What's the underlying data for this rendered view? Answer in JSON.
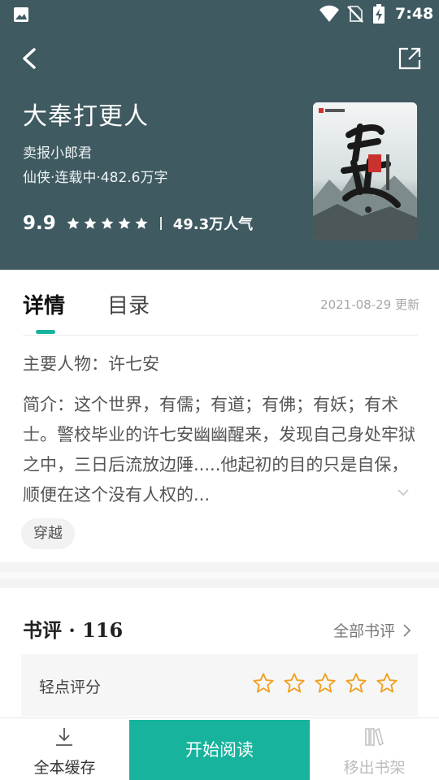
{
  "status_bar": {
    "time": "7:48"
  },
  "book": {
    "title": "大奉打更人",
    "author": "卖报小郎君",
    "meta": "仙侠·连载中·482.6万字",
    "score": "9.9",
    "popularity": "49.3万人气",
    "star_count": 5
  },
  "tabs": [
    {
      "label": "详情",
      "active": true
    },
    {
      "label": "目录",
      "active": false
    }
  ],
  "update_date": "2021-08-29 更新",
  "detail": {
    "main_character": "主要人物：许七安",
    "intro": "简介：这个世界，有儒；有道；有佛；有妖；有术士。警校毕业的许七安幽幽醒来，发现自己身处牢狱之中，三日后流放边陲.....他起初的目的只是自保，顺便在这个没有人权的..."
  },
  "tags": [
    "穿越"
  ],
  "reviews": {
    "title": "书评 · 116",
    "all_label": "全部书评",
    "rate_label": "轻点评分",
    "rate_star_count": 5
  },
  "bottom_bar": {
    "cache_label": "全本缓存",
    "read_label": "开始阅读",
    "remove_label": "移出书架"
  },
  "colors": {
    "header_bg": "#3f5a60",
    "accent": "#17b39c",
    "star_outline": "#f0a020"
  },
  "icons": [
    "image-icon",
    "wifi-icon",
    "no-sim-icon",
    "battery-charging-icon",
    "back-arrow-icon",
    "share-icon",
    "star-icon",
    "chevron-down-icon",
    "chevron-right-icon",
    "download-icon",
    "bookshelf-icon"
  ]
}
